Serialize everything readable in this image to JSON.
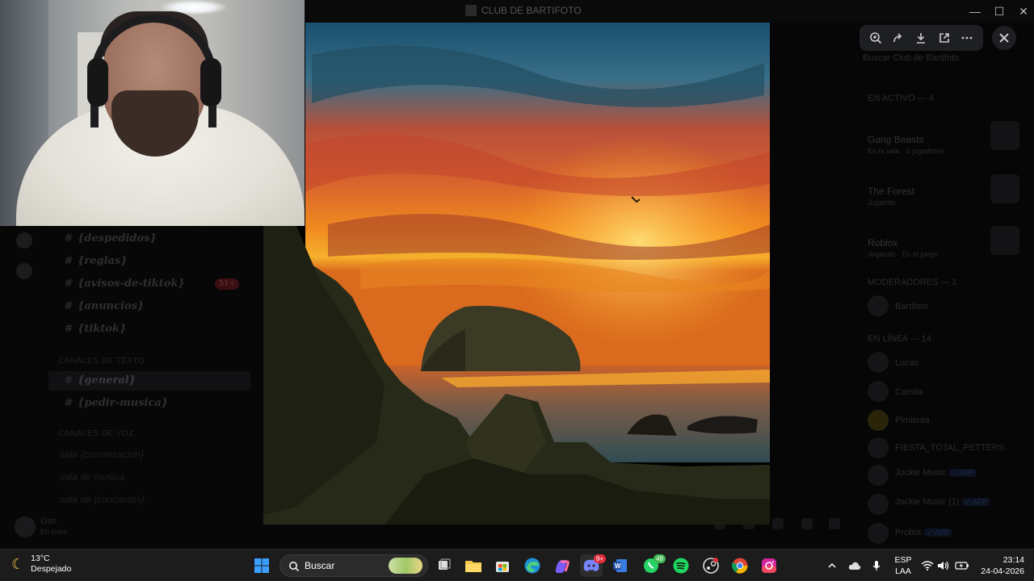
{
  "window": {
    "title": "CLUB DE BARTIFOTO",
    "controls": {
      "minimize": "—",
      "maximize": "☐",
      "close": "✕"
    }
  },
  "sidebar": {
    "channels": [
      {
        "name": "{despedidos}",
        "hash": "#"
      },
      {
        "name": "{reglas}",
        "hash": "#"
      },
      {
        "name": "{avisos-de-tiktok}",
        "hash": "#",
        "badge": "51+"
      },
      {
        "name": "{anuncios}",
        "hash": "#"
      },
      {
        "name": "{tiktok}",
        "hash": "#"
      }
    ],
    "categories": [
      "CANALES DE TEXTO",
      "CANALES DE VOZ"
    ],
    "text_channels": [
      {
        "name": "{general}",
        "hash": "#",
        "active": true
      },
      {
        "name": "{pedir-musica}",
        "hash": "#"
      }
    ],
    "voice_channels": [
      "sala {conversacion}",
      "sala de musica",
      "sala de {conciertos}"
    ],
    "user": {
      "name": "Dan",
      "status": "En línea"
    }
  },
  "viewer": {
    "toolbar": [
      {
        "icon": "zoom-in-icon",
        "label": "⊕"
      },
      {
        "icon": "forward-icon",
        "label": "↪"
      },
      {
        "icon": "download-icon",
        "label": "⤓"
      },
      {
        "icon": "open-external-icon",
        "label": "⧉"
      },
      {
        "icon": "more-icon",
        "label": "⋯"
      }
    ],
    "close_label": "✕"
  },
  "right_panel": {
    "search": "Buscar Club de Bartifoto",
    "section_active": "EN ACTIVO — 4",
    "activities": [
      {
        "title": "Gang Beasts",
        "sub": "En la sala · 3 jugadores"
      },
      {
        "title": "The Forest",
        "sub": "Jugando"
      },
      {
        "title": "Roblox",
        "sub": "Jugando · En el juego"
      }
    ],
    "section_mods": "MODERADORES — 1",
    "section_online": "EN LÍNEA — 14",
    "members": [
      {
        "name": "Bartifoto"
      },
      {
        "name": "Lucas"
      },
      {
        "name": "Camila"
      },
      {
        "name": "Pimienta"
      },
      {
        "name": "FIESTA_TOTAL_PETTERS"
      },
      {
        "name": "Jockie Music",
        "tag": "✓ APP"
      },
      {
        "name": "Jockie Music (1)",
        "tag": "✓ APP"
      },
      {
        "name": "Probot",
        "tag": "✓ APP"
      }
    ]
  },
  "taskbar": {
    "weather": {
      "temp": "13°C",
      "desc": "Despejado"
    },
    "search_placeholder": "Buscar",
    "apps": [
      {
        "icon": "windows-start-icon"
      },
      {
        "icon": "task-view-icon"
      },
      {
        "icon": "file-explorer-icon"
      },
      {
        "icon": "microsoft-store-icon"
      },
      {
        "icon": "edge-icon"
      },
      {
        "icon": "copilot-icon"
      },
      {
        "icon": "discord-icon",
        "badge": "9+"
      },
      {
        "icon": "word-icon"
      },
      {
        "icon": "whatsapp-icon",
        "badge": "49"
      },
      {
        "icon": "spotify-icon"
      },
      {
        "icon": "steam-icon"
      },
      {
        "icon": "chrome-icon"
      },
      {
        "icon": "instagram-icon"
      }
    ],
    "lang": {
      "line1": "ESP",
      "line2": "LAA"
    },
    "clock": {
      "time": "23:14",
      "date": "24-04-2026"
    }
  }
}
